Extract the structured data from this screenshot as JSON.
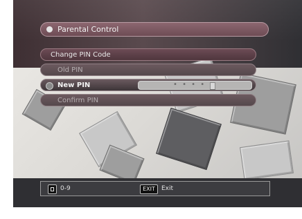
{
  "menu": {
    "title": "Parental Control",
    "section": "Change PIN Code",
    "items": [
      {
        "label": "Old PIN"
      },
      {
        "label": "New PIN",
        "value_mask": "• • • •"
      },
      {
        "label": "Confirm PIN"
      }
    ]
  },
  "help": {
    "key1_label": "0-9",
    "key2_label": "EXIT",
    "key2_text": "Exit"
  }
}
